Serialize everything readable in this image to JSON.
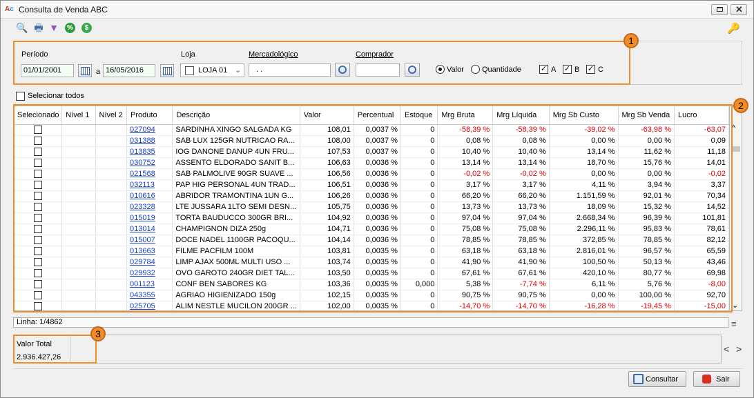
{
  "window": {
    "title": "Consulta de Venda ABC"
  },
  "toolbar": {
    "icons": [
      "preview-icon",
      "print-icon",
      "filter-icon",
      "percent-icon",
      "currency-icon"
    ],
    "percent_glyph": "%",
    "currency_glyph": "$"
  },
  "filters": {
    "periodo_label": "Período",
    "date_from": "01/01/2001",
    "date_sep": "a",
    "date_to": "16/05/2016",
    "loja_label": "Loja",
    "loja_value": "LOJA 01",
    "mercadologico_label": "Mercadológico",
    "mercadologico_value": ". .",
    "comprador_label": "Comprador",
    "comprador_value": "",
    "radio_valor": "Valor",
    "radio_quantidade": "Quantidade",
    "check_a": "A",
    "check_b": "B",
    "check_c": "C",
    "checkmark": "✓"
  },
  "badges": {
    "one": "1",
    "two": "2",
    "three": "3"
  },
  "select_all_label": "Selecionar todos",
  "columns": [
    "Selecionado",
    "Nível 1",
    "Nível 2",
    "Produto",
    "Descrição",
    "Valor",
    "Percentual",
    "Estoque",
    "Mrg Bruta",
    "Mrg Líquida",
    "Mrg Sb Custo",
    "Mrg Sb Venda",
    "Lucro"
  ],
  "rows": [
    [
      "027094",
      "SARDINHA XINGO SALGADA KG",
      "108,01",
      "0,0037 %",
      "0",
      "-58,39 %",
      "-58,39 %",
      "-39,02 %",
      "-63,98 %",
      "-63,07"
    ],
    [
      "031388",
      "SAB LUX 125GR NUTRICAO RA...",
      "108,00",
      "0,0037 %",
      "0",
      "0,08 %",
      "0,08 %",
      "0,00 %",
      "0,00 %",
      "0,09"
    ],
    [
      "013835",
      "IOG DANONE DANUP 4UN FRU...",
      "107,53",
      "0,0037 %",
      "0",
      "10,40 %",
      "10,40 %",
      "13,14 %",
      "11,62 %",
      "11,18"
    ],
    [
      "030752",
      "ASSENTO ELDORADO SANIT B...",
      "106,63",
      "0,0036 %",
      "0",
      "13,14 %",
      "13,14 %",
      "18,70 %",
      "15,76 %",
      "14,01"
    ],
    [
      "021568",
      "SAB PALMOLIVE 90GR SUAVE ...",
      "106,56",
      "0,0036 %",
      "0",
      "-0,02 %",
      "-0,02 %",
      "0,00 %",
      "0,00 %",
      "-0,02"
    ],
    [
      "032113",
      "PAP HIG PERSONAL 4UN TRAD...",
      "106,51",
      "0,0036 %",
      "0",
      "3,17 %",
      "3,17 %",
      "4,11 %",
      "3,94 %",
      "3,37"
    ],
    [
      "010616",
      "ABRIDOR TRAMONTINA 1UN G...",
      "106,26",
      "0,0036 %",
      "0",
      "66,20 %",
      "66,20 %",
      "1.151,59 %",
      "92,01 %",
      "70,34"
    ],
    [
      "023328",
      "LTE JUSSARA 1LTO SEMI DESN...",
      "105,75",
      "0,0036 %",
      "0",
      "13,73 %",
      "13,73 %",
      "18,09 %",
      "15,32 %",
      "14,52"
    ],
    [
      "015019",
      "TORTA BAUDUCCO 300GR BRI...",
      "104,92",
      "0,0036 %",
      "0",
      "97,04 %",
      "97,04 %",
      "2.668,34 %",
      "96,39 %",
      "101,81"
    ],
    [
      "013014",
      "CHAMPIGNON DIZA 250g",
      "104,71",
      "0,0036 %",
      "0",
      "75,08 %",
      "75,08 %",
      "2.296,11 %",
      "95,83 %",
      "78,61"
    ],
    [
      "015007",
      "DOCE NADEL 1100GR PACOQU...",
      "104,14",
      "0,0036 %",
      "0",
      "78,85 %",
      "78,85 %",
      "372,85 %",
      "78,85 %",
      "82,12"
    ],
    [
      "013663",
      "FILME PACFILM 100M",
      "103,81",
      "0,0035 %",
      "0",
      "63,18 %",
      "63,18 %",
      "2.816,01 %",
      "96,57 %",
      "65,59"
    ],
    [
      "029784",
      "LIMP AJAX 500ML MULTI USO ...",
      "103,74",
      "0,0035 %",
      "0",
      "41,90 %",
      "41,90 %",
      "100,50 %",
      "50,13 %",
      "43,46"
    ],
    [
      "029932",
      "OVO GAROTO 240GR DIET TAL...",
      "103,50",
      "0,0035 %",
      "0",
      "67,61 %",
      "67,61 %",
      "420,10 %",
      "80,77 %",
      "69,98"
    ],
    [
      "001123",
      "CONF BEN SABORES KG",
      "103,36",
      "0,0035 %",
      "0,000",
      "5,38 %",
      "-7,74 %",
      "6,11 %",
      "5,76 %",
      "-8,00"
    ],
    [
      "043355",
      "AGRIAO HIGIENIZADO 150g",
      "102,15",
      "0,0035 %",
      "0",
      "90,75 %",
      "90,75 %",
      "0,00 %",
      "100,00 %",
      "92,70"
    ],
    [
      "025705",
      "ALIM NESTLE MUCILON 200GR ...",
      "102,00",
      "0,0035 %",
      "0",
      "-14,70 %",
      "-14,70 %",
      "-16,28 %",
      "-19,45 %",
      "-15,00"
    ]
  ],
  "status": {
    "line": "Linha: 1/4862"
  },
  "totals": {
    "label": "Valor Total",
    "value": "2.936.427,26"
  },
  "nav": {
    "prev": "<",
    "next": ">"
  },
  "buttons": {
    "consultar": "Consultar",
    "sair": "Sair"
  },
  "colors": {
    "highlight": "#f28c28",
    "negative": "#e00000",
    "link": "#1a3cc8"
  }
}
